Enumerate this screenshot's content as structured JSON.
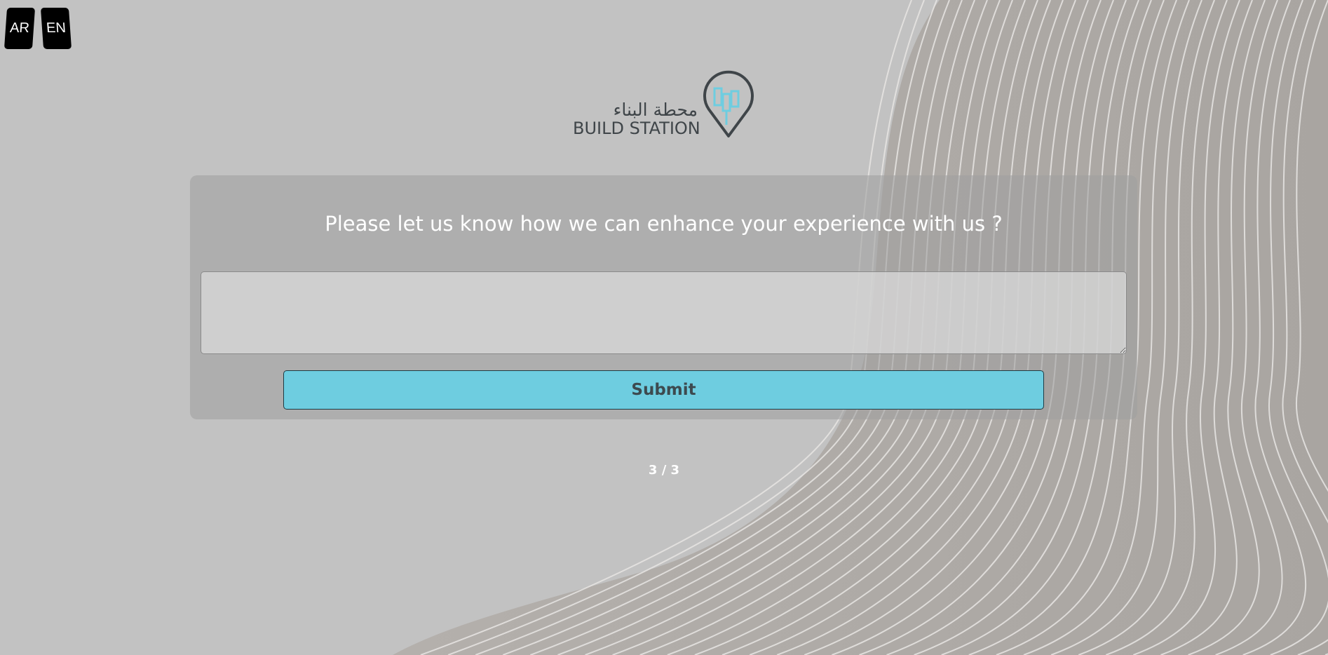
{
  "language_switcher": {
    "ar_label": "AR",
    "en_label": "EN"
  },
  "logo": {
    "arabic_name": "محطة البناء",
    "english_name": "BUILD STATION",
    "icon": "map-pin-building-icon",
    "text_color": "#3f4549",
    "accent_color": "#6ecde0"
  },
  "survey": {
    "question": "Please let us know how we can enhance your experience with us ?",
    "answer_value": "",
    "submit_label": "Submit",
    "submit_color": "#6ecde0"
  },
  "progress": {
    "text": "3 / 3",
    "current": 3,
    "total": 3
  }
}
